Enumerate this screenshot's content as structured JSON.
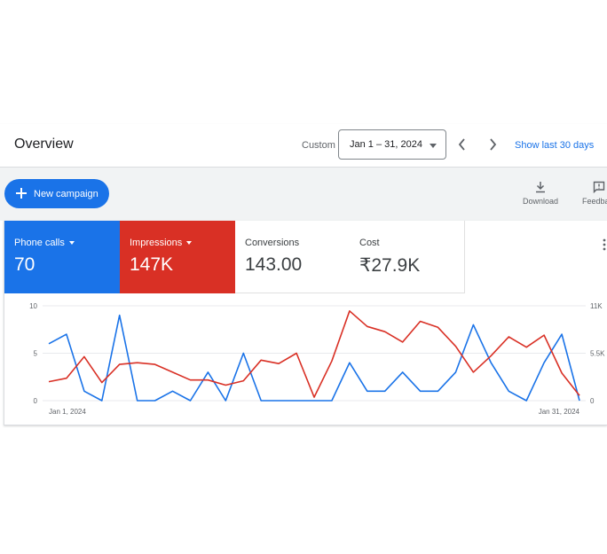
{
  "header": {
    "title": "Overview",
    "custom_label": "Custom",
    "date_range": "Jan 1 – 31, 2024",
    "show_last": "Show last 30 days"
  },
  "toolbar": {
    "new_campaign": "New campaign",
    "download": "Download",
    "feedback": "Feedba"
  },
  "cards": [
    {
      "name": "Phone calls",
      "value": "70",
      "has_dropdown": true,
      "color": "#1a73e8"
    },
    {
      "name": "Impressions",
      "value": "147K",
      "has_dropdown": true,
      "color": "#d93025"
    },
    {
      "name": "Conversions",
      "value": "143.00",
      "has_dropdown": false
    },
    {
      "name": "Cost",
      "value": "₹27.9K",
      "has_dropdown": false
    }
  ],
  "chart_data": {
    "type": "line",
    "x_start_label": "Jan 1, 2024",
    "x_end_label": "Jan 31, 2024",
    "left_ticks": [
      "10",
      "5",
      "0"
    ],
    "right_ticks": [
      "11K",
      "5.5K",
      "0"
    ],
    "left_ylim": [
      0,
      10
    ],
    "right_ylim": [
      0,
      11000
    ],
    "grid": true,
    "series": [
      {
        "axis": "left",
        "color": "#1a73e8",
        "values": [
          6,
          7,
          1,
          0,
          9,
          0,
          0,
          1,
          0,
          3,
          0,
          5,
          0,
          0,
          0,
          0,
          0,
          4,
          1,
          1,
          3,
          1,
          1,
          3,
          8,
          4,
          1,
          0,
          4,
          7,
          0
        ]
      },
      {
        "axis": "right",
        "color": "#d93025",
        "values": [
          2200,
          2600,
          5100,
          2100,
          4200,
          4400,
          4200,
          3300,
          2400,
          2400,
          1800,
          2300,
          4700,
          4300,
          5500,
          400,
          4600,
          10400,
          8600,
          8000,
          6800,
          9200,
          8500,
          6300,
          3300,
          5200,
          7400,
          6200,
          7600,
          3200,
          600
        ]
      }
    ]
  }
}
